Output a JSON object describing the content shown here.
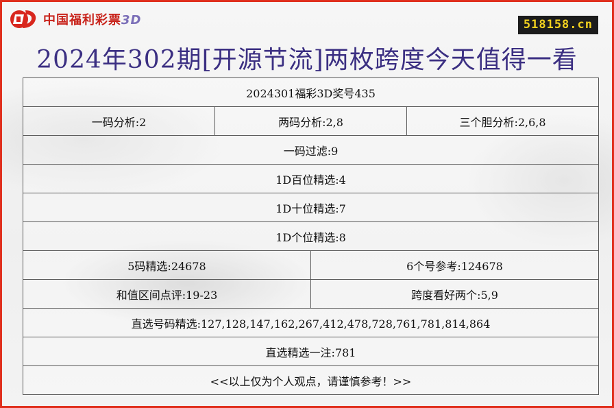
{
  "logo": {
    "text": "中国福利彩票",
    "suffix": "3D"
  },
  "site_badge": "518158.cn",
  "title": "2024年302期[开源节流]两枚跨度今天值得一看",
  "rows": {
    "r1": "2024301福彩3D奖号435",
    "r2": [
      "一码分析:2",
      "两码分析:2,8",
      "三个胆分析:2,6,8"
    ],
    "r3": "一码过滤:9",
    "r4": "1D百位精选:4",
    "r5": "1D十位精选:7",
    "r6": "1D个位精选:8",
    "r7": [
      "5码精选:24678",
      "6个号参考:124678"
    ],
    "r8": [
      "和值区间点评:19-23",
      "跨度看好两个:5,9"
    ],
    "r9": "直选号码精选:127,128,147,162,267,412,478,728,761,781,814,864",
    "r10": "直选精选一注:781",
    "r11": "<<以上仅为个人观点，请谨慎参考！>>"
  },
  "colors": {
    "title": "#3b2f82",
    "frame": "#e0301e",
    "logo": "#c8231b",
    "badge_bg": "#1c1c1c",
    "badge_fg": "#f4d21f"
  }
}
